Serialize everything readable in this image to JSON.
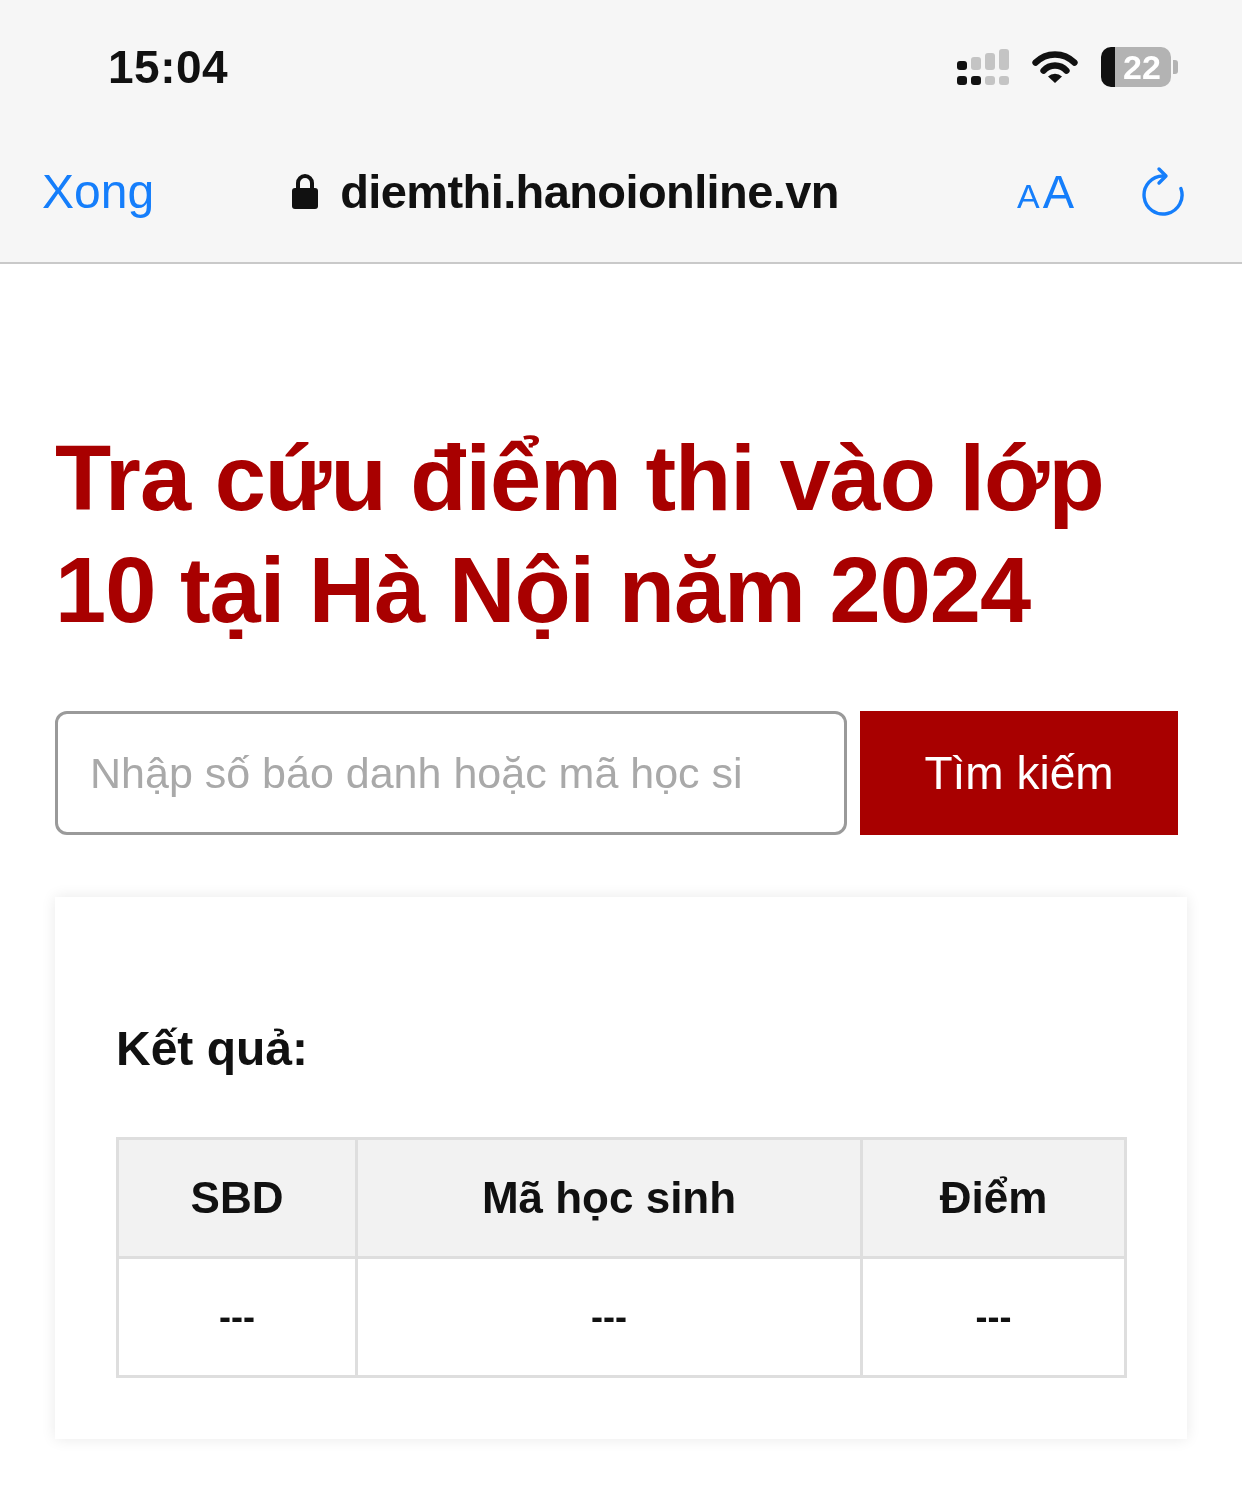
{
  "status_bar": {
    "time": "15:04",
    "battery": "22"
  },
  "browser_bar": {
    "done_button": "Xong",
    "secure": true,
    "url": "diemthi.hanoionline.vn",
    "text_size_button": {
      "small": "A",
      "large": "A"
    }
  },
  "page": {
    "title": "Tra cứu điểm thi vào lớp 10 tại Hà Nội năm 2024",
    "search": {
      "placeholder": "Nhập số báo danh hoặc mã học si",
      "button": "Tìm kiếm"
    },
    "results": {
      "heading": "Kết quả:",
      "table": {
        "columns": [
          "SBD",
          "Mã học sinh",
          "Điểm"
        ],
        "rows": [
          [
            "---",
            "---",
            "---"
          ]
        ]
      }
    }
  }
}
